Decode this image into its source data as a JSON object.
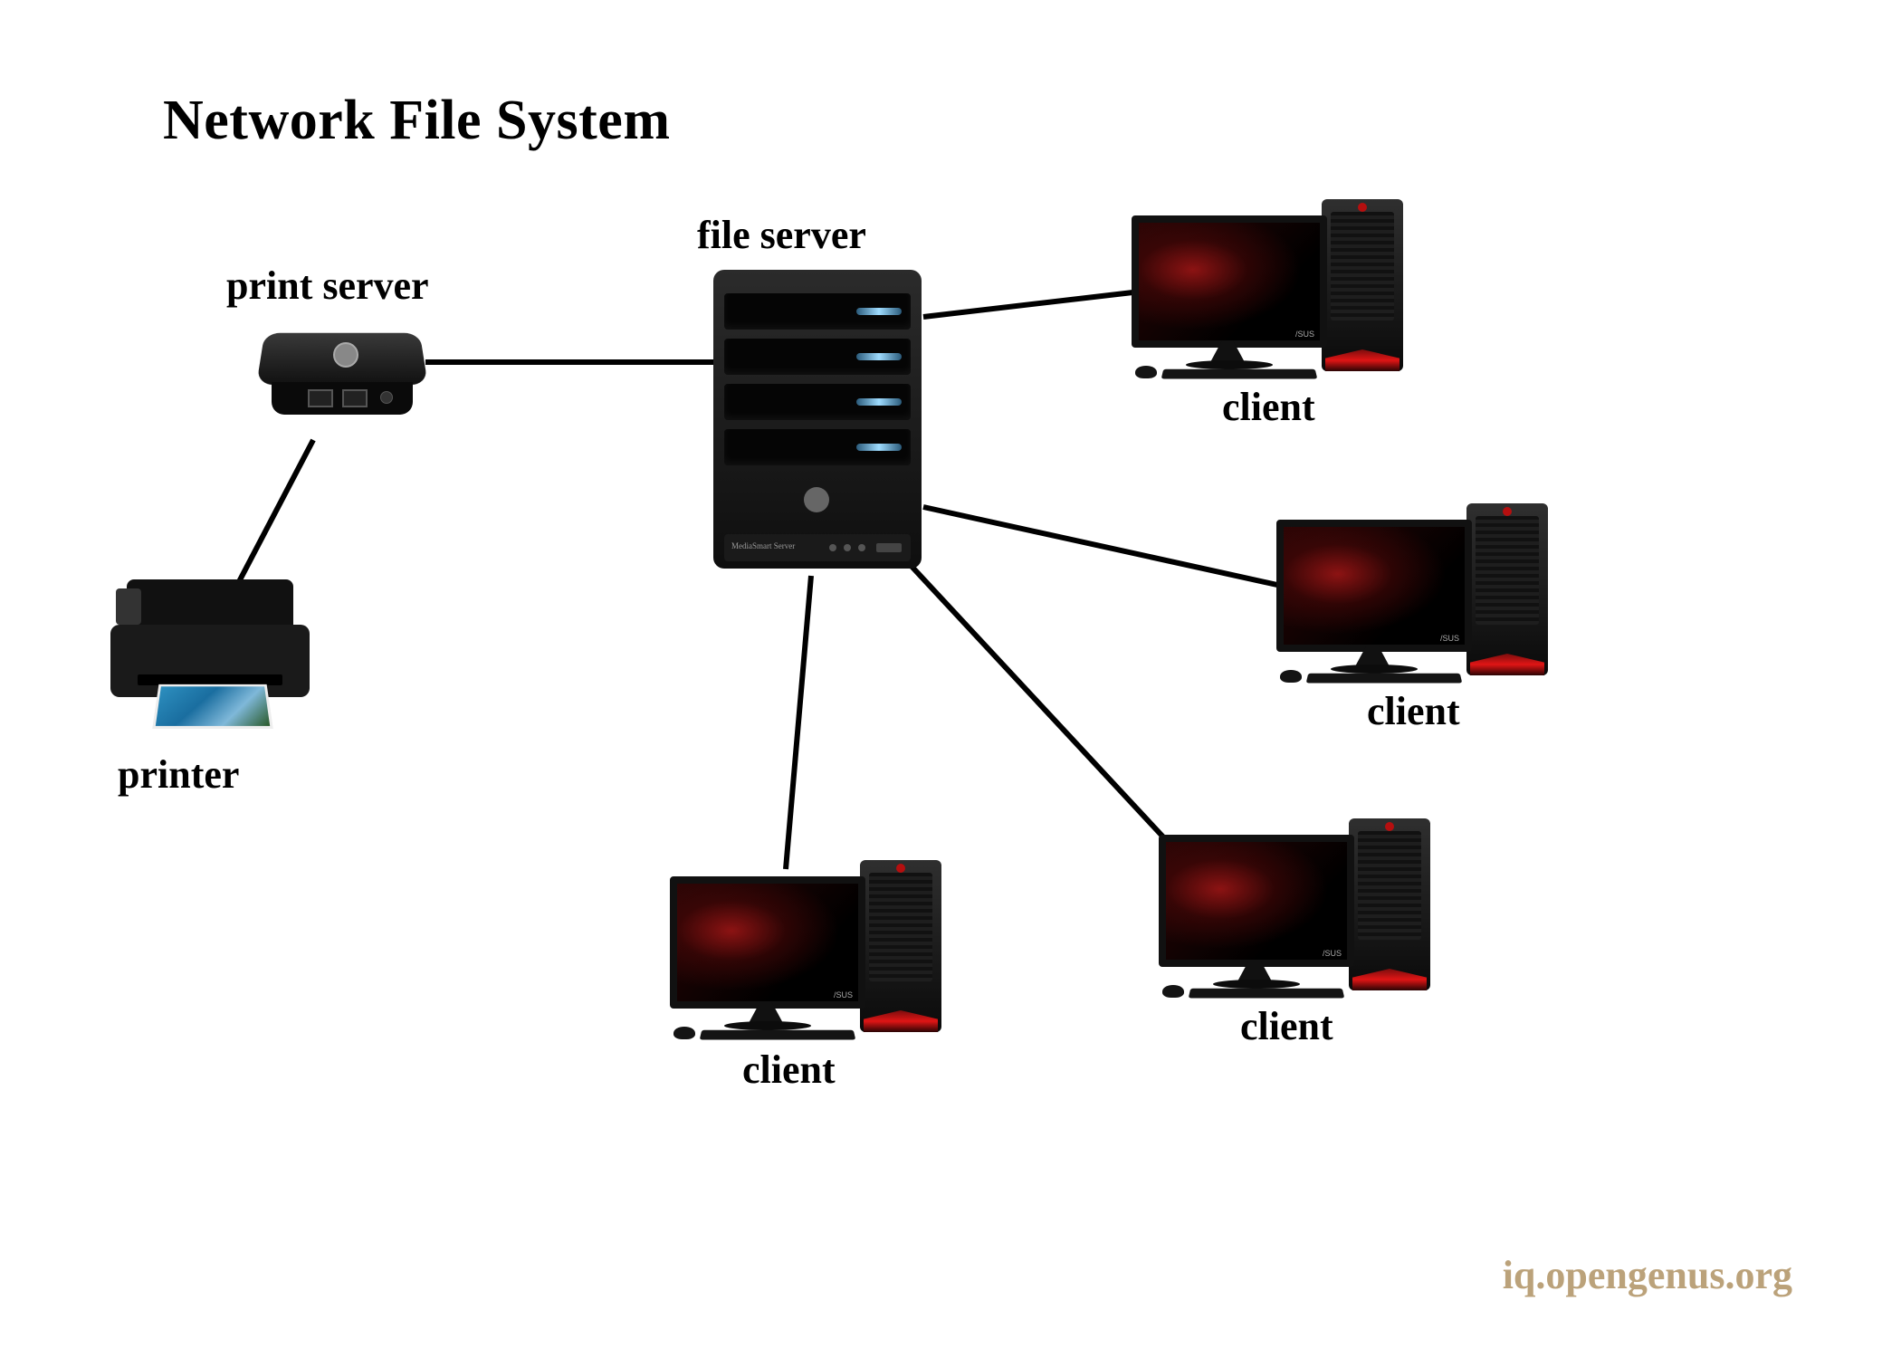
{
  "title": "Network File System",
  "watermark": "iq.opengenus.org",
  "nodes": {
    "fileserver": {
      "label": "file server"
    },
    "printserver": {
      "label": "print server"
    },
    "printer": {
      "label": "printer"
    },
    "client1": {
      "label": "client"
    },
    "client2": {
      "label": "client"
    },
    "client3": {
      "label": "client"
    },
    "client4": {
      "label": "client"
    }
  },
  "edges": [
    {
      "from": "printserver",
      "to": "fileserver"
    },
    {
      "from": "printer",
      "to": "printserver"
    },
    {
      "from": "fileserver",
      "to": "client1"
    },
    {
      "from": "fileserver",
      "to": "client2"
    },
    {
      "from": "fileserver",
      "to": "client3"
    },
    {
      "from": "fileserver",
      "to": "client4"
    }
  ]
}
